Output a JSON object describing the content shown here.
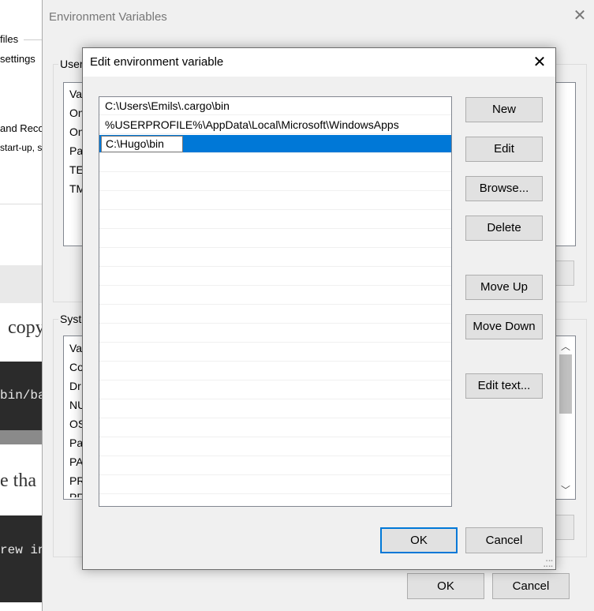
{
  "background_page": {
    "files": "files",
    "settings": "settings",
    "and_reco": "and Reco",
    "startup": "start-up, s",
    "copy": "copy",
    "code1": "bin/ba",
    "that": "e tha",
    "code2": "rew in"
  },
  "env_window": {
    "title": "Environment Variables",
    "user_group_label": "User",
    "user_rows": [
      "Va",
      "On",
      "On",
      "Pa",
      "TE",
      "TM"
    ],
    "system_group_label": "Syste",
    "system_rows": [
      "Va",
      "Co",
      "Dr",
      "NU",
      "OS",
      "Pa",
      "PA",
      "PR",
      "PR"
    ],
    "ok_label": "OK",
    "cancel_label": "Cancel"
  },
  "dialog": {
    "title": "Edit environment variable",
    "paths": [
      "C:\\Users\\Emils\\.cargo\\bin",
      "%USERPROFILE%\\AppData\\Local\\Microsoft\\WindowsApps"
    ],
    "editing_value": "C:\\Hugo\\bin",
    "buttons": {
      "new": "New",
      "edit": "Edit",
      "browse": "Browse...",
      "delete": "Delete",
      "move_up": "Move Up",
      "move_down": "Move Down",
      "edit_text": "Edit text..."
    },
    "ok_label": "OK",
    "cancel_label": "Cancel"
  },
  "colors": {
    "selection": "#0078d7",
    "dialog_bg": "#f0f0f0",
    "default_button_border": "#0078d7"
  }
}
